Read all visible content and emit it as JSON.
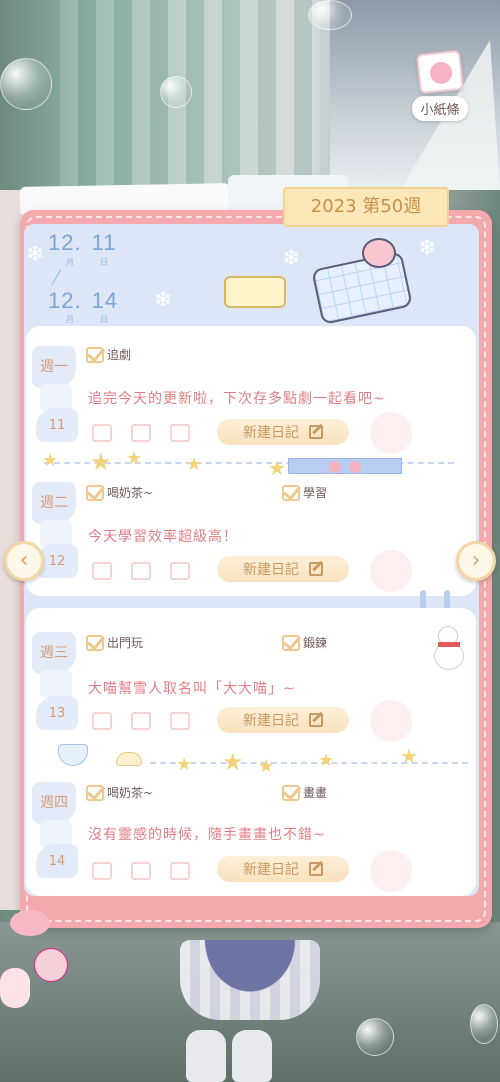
{
  "note_widget": {
    "label": "小紙條",
    "icon": "note-paper-icon"
  },
  "week_tab": "2023 第50週",
  "date_range": {
    "start": {
      "month": "12.",
      "day": "11",
      "month_unit": "月",
      "day_unit": "日"
    },
    "end": {
      "month": "12.",
      "day": "14",
      "month_unit": "月",
      "day_unit": "日"
    }
  },
  "new_diary_label": "新建日記",
  "days": [
    {
      "weekday": "週一",
      "date": "11",
      "checks": [
        "追劇"
      ],
      "diary": "追完今天的更新啦，下次存多點劇一起看吧~"
    },
    {
      "weekday": "週二",
      "date": "12",
      "checks": [
        "喝奶茶~",
        "學習"
      ],
      "diary": "今天學習效率超級高！"
    },
    {
      "weekday": "週三",
      "date": "13",
      "checks": [
        "出門玩",
        "鍛鍊"
      ],
      "diary": "大喵幫雪人取名叫「大大喵」~"
    },
    {
      "weekday": "週四",
      "date": "14",
      "checks": [
        "喝奶茶~",
        "畫畫"
      ],
      "diary": "沒有靈感的時候，隨手畫畫也不錯~"
    }
  ],
  "nav": {
    "prev": "‹",
    "next": "›"
  },
  "colors": {
    "notebook_border": "#f3a9ae",
    "page_bg": "#dce6f7",
    "accent_text": "#e07e87",
    "button_text": "#c89a62",
    "checkbox": "#f0c78d"
  }
}
